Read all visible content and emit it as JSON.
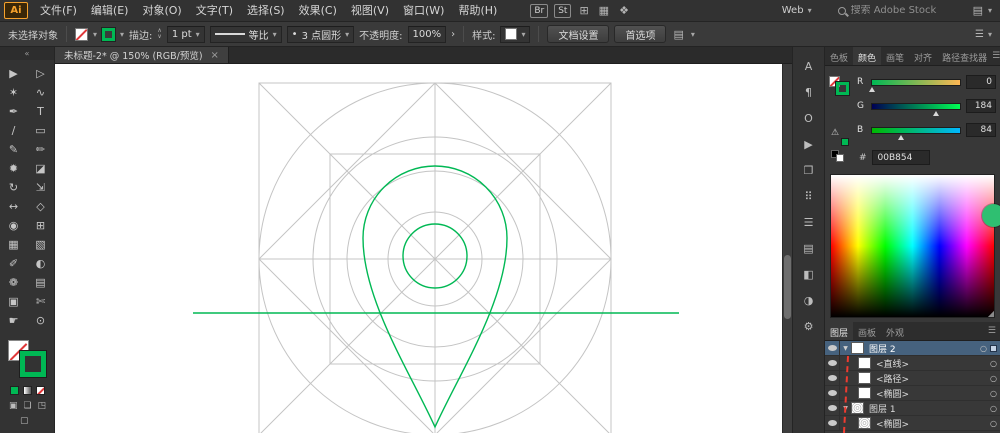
{
  "app": {
    "logo": "Ai",
    "workspace_label": "Web",
    "search_placeholder": "搜索 Adobe Stock",
    "accent_green": "#00B854"
  },
  "icons": {
    "chevron_down": "▾",
    "stepper_up": "∧",
    "stepper_down": "∨",
    "more_chevron": "›",
    "panel_menu": "☰",
    "collapse_left": "«",
    "expander_open": "▼",
    "target_circle": "○",
    "resize_grip": "◢",
    "close": "×",
    "grid_view": "⊞",
    "layout_view": "▦",
    "share": "❖",
    "arrange_docs": "▤",
    "brush_dot": "•"
  },
  "menu": {
    "items": [
      "文件(F)",
      "编辑(E)",
      "对象(O)",
      "文字(T)",
      "选择(S)",
      "效果(C)",
      "视图(V)",
      "窗口(W)",
      "帮助(H)"
    ],
    "badges": {
      "bridge": "Br",
      "stock": "St"
    }
  },
  "control_bar": {
    "selection_status": "未选择对象",
    "stroke_label": "描边:",
    "stroke_value": "1 pt",
    "width_profile": "等比",
    "brush": "3 点圆形",
    "opacity_label": "不透明度:",
    "opacity_value": "100%",
    "style_label": "样式:",
    "document_setup": "文档设置",
    "preferences": "首选项"
  },
  "document": {
    "tab_title": "未标题-2* @ 150% (RGB/预览)"
  },
  "tools": [
    {
      "name": "selection-tool",
      "glyph": "▶"
    },
    {
      "name": "direct-selection-tool",
      "glyph": "▷"
    },
    {
      "name": "magic-wand-tool",
      "glyph": "✶"
    },
    {
      "name": "lasso-tool",
      "glyph": "∿"
    },
    {
      "name": "pen-tool",
      "glyph": "✒"
    },
    {
      "name": "type-tool",
      "glyph": "T"
    },
    {
      "name": "line-segment-tool",
      "glyph": "∕"
    },
    {
      "name": "rectangle-tool",
      "glyph": "▭"
    },
    {
      "name": "paintbrush-tool",
      "glyph": "✎"
    },
    {
      "name": "pencil-tool",
      "glyph": "✏"
    },
    {
      "name": "blob-brush-tool",
      "glyph": "✹"
    },
    {
      "name": "eraser-tool",
      "glyph": "◪"
    },
    {
      "name": "rotate-tool",
      "glyph": "↻"
    },
    {
      "name": "scale-tool",
      "glyph": "⇲"
    },
    {
      "name": "width-tool",
      "glyph": "↔"
    },
    {
      "name": "free-transform-tool",
      "glyph": "◇"
    },
    {
      "name": "shape-builder-tool",
      "glyph": "◉"
    },
    {
      "name": "perspective-grid-tool",
      "glyph": "⊞"
    },
    {
      "name": "mesh-tool",
      "glyph": "▦"
    },
    {
      "name": "gradient-tool",
      "glyph": "▧"
    },
    {
      "name": "eyedropper-tool",
      "glyph": "✐"
    },
    {
      "name": "blend-tool",
      "glyph": "◐"
    },
    {
      "name": "symbol-sprayer-tool",
      "glyph": "❁"
    },
    {
      "name": "column-graph-tool",
      "glyph": "▤"
    },
    {
      "name": "artboard-tool",
      "glyph": "▣"
    },
    {
      "name": "slice-tool",
      "glyph": "✄"
    },
    {
      "name": "hand-tool",
      "glyph": "☛"
    },
    {
      "name": "zoom-tool",
      "glyph": "⊙"
    }
  ],
  "right_dock": [
    {
      "name": "character-panel-icon",
      "glyph": "A"
    },
    {
      "name": "paragraph-panel-icon",
      "glyph": "¶"
    },
    {
      "name": "opentype-panel-icon",
      "glyph": "O"
    },
    {
      "name": "actions-panel-icon",
      "glyph": "▶"
    },
    {
      "name": "libraries-panel-icon",
      "glyph": "❐"
    },
    {
      "name": "symbols-panel-icon",
      "glyph": "⠿"
    },
    {
      "name": "stroke-panel-icon",
      "glyph": "☰"
    },
    {
      "name": "graphic-styles-panel-icon",
      "glyph": "▤"
    },
    {
      "name": "gradient-panel-icon",
      "glyph": "◧"
    },
    {
      "name": "transparency-panel-icon",
      "glyph": "◑"
    },
    {
      "name": "settings-panel-icon",
      "glyph": "⚙"
    }
  ],
  "color_panel": {
    "tabs": [
      {
        "name": "tab-swatches",
        "label": "色板",
        "active": false
      },
      {
        "name": "tab-color",
        "label": "颜色",
        "active": true
      },
      {
        "name": "tab-brushes",
        "label": "画笔",
        "active": false
      },
      {
        "name": "tab-align",
        "label": "对齐",
        "active": false
      },
      {
        "name": "tab-pathfinder",
        "label": "路径查找器",
        "active": false
      }
    ],
    "channels": [
      {
        "label": "R",
        "value": "0"
      },
      {
        "label": "G",
        "value": "184"
      },
      {
        "label": "B",
        "value": "84"
      }
    ],
    "hex_label": "#",
    "hex_value": "00B854"
  },
  "layers_panel": {
    "tabs": [
      {
        "name": "tab-layers",
        "label": "图层",
        "active": true
      },
      {
        "name": "tab-artboards",
        "label": "画板",
        "active": false
      },
      {
        "name": "tab-appearance",
        "label": "外观",
        "active": false
      }
    ],
    "rows": [
      {
        "label": "图层 2",
        "kind": "layer",
        "selected": true,
        "art": false
      },
      {
        "label": "<直线>",
        "kind": "object",
        "selected": false,
        "art": false
      },
      {
        "label": "<路径>",
        "kind": "object",
        "selected": false,
        "art": false
      },
      {
        "label": "<椭圆>",
        "kind": "object",
        "selected": false,
        "art": false
      },
      {
        "label": "图层 1",
        "kind": "layer",
        "selected": false,
        "art": true
      },
      {
        "label": "<椭圆>",
        "kind": "object",
        "selected": false,
        "art": true
      }
    ]
  }
}
